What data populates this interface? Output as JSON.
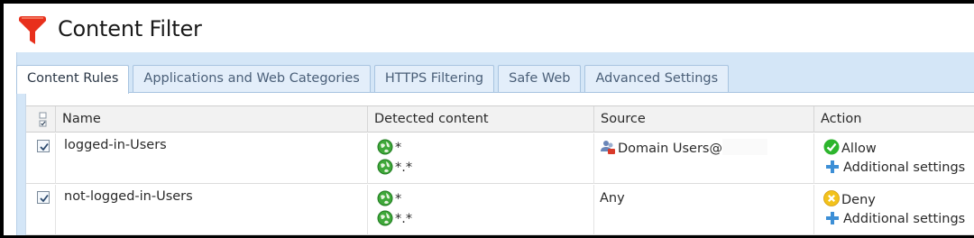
{
  "header": {
    "title": "Content Filter",
    "logo_icon": "funnel-icon"
  },
  "tabs": [
    {
      "label": "Content Rules",
      "active": true
    },
    {
      "label": "Applications and Web Categories",
      "active": false
    },
    {
      "label": "HTTPS Filtering",
      "active": false
    },
    {
      "label": "Safe Web",
      "active": false
    },
    {
      "label": "Advanced Settings",
      "active": false
    }
  ],
  "table": {
    "columns": {
      "name": "Name",
      "detected": "Detected content",
      "source": "Source",
      "action": "Action"
    },
    "rows": [
      {
        "enabled": true,
        "name": "logged-in-Users",
        "detected": [
          "*",
          "*.*"
        ],
        "source": "Domain Users@",
        "source_icon": "user-group-icon",
        "action": "Allow",
        "action_icon": "check-icon",
        "settings": "Additional settings"
      },
      {
        "enabled": true,
        "name": "not-logged-in-Users",
        "detected": [
          "*",
          "*.*"
        ],
        "source": "Any",
        "action": "Deny",
        "action_icon": "deny-icon",
        "settings": "Additional settings"
      }
    ]
  },
  "colors": {
    "accent": "#e8301c",
    "panel": "#d4e6f7",
    "allow": "#2db52d",
    "deny": "#f2c21b",
    "plus": "#3d8fd6"
  }
}
